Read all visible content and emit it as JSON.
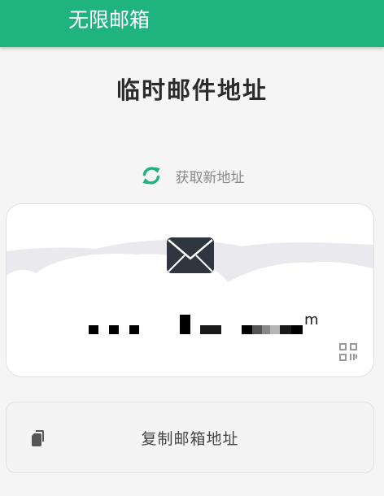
{
  "app_bar": {
    "title": "无限邮箱",
    "color": "#1fb380"
  },
  "page": {
    "title": "临时邮件地址"
  },
  "refresh": {
    "label": "获取新地址",
    "icon": "refresh-icon"
  },
  "mail_card": {
    "address_suffix": "m",
    "envelope_icon": "envelope-icon",
    "qr_icon": "qr-code-icon"
  },
  "copy": {
    "label": "复制邮箱地址",
    "icon": "copy-icon"
  }
}
